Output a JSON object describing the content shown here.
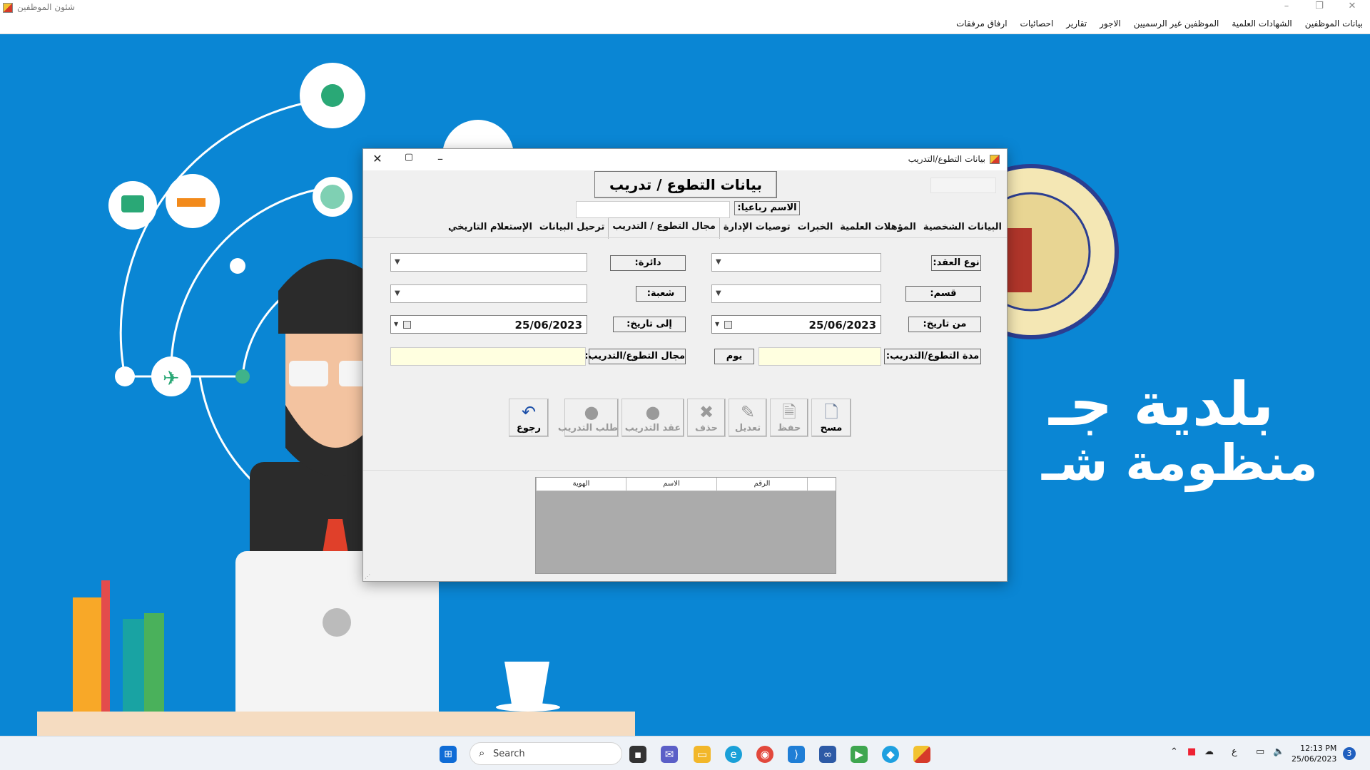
{
  "app": {
    "title": "شئون الموظفين",
    "menu": [
      "بيانات الموظفين",
      "الشهادات العلمية",
      "الموظفين غير الرسميين",
      "الاجور",
      "تقارير",
      "احصائيات",
      "ارفاق مرفقات"
    ]
  },
  "background": {
    "line1": "بلدية جـ",
    "line2": "منظومة شـ"
  },
  "dialog": {
    "title": "بيانات التطوع/التدريب",
    "header": "بيانات التطوع / تدريب",
    "name_label": "الاسم رباعيا:",
    "name_value": "",
    "tabs": [
      "البيانات الشخصية",
      "المؤهلات العلمية",
      "الخبرات",
      "توصيات الإدارة",
      "مجال التطوع / التدريب",
      "ترحيل البيانات",
      "الإستعلام التاريخي"
    ],
    "active_tab": 4,
    "form": {
      "contract_type_label": "نوع العقد:",
      "contract_type_value": "",
      "department_label": "دائرة:",
      "department_value": "",
      "section_label": "قسم:",
      "section_value": "",
      "division_label": "شعبة:",
      "division_value": "",
      "from_date_label": "من تاريخ:",
      "from_date_value": "25/06/2023",
      "to_date_label": "إلى تاريخ:",
      "to_date_value": "25/06/2023",
      "duration_label": "مدة التطوع/التدريب:",
      "duration_value": "",
      "day_label": "يوم",
      "field_label": "مجال التطوع/التدريب:",
      "field_value": ""
    },
    "buttons": {
      "new": "مسح",
      "save": "حفظ",
      "edit": "تعديل",
      "delete": "حذف",
      "training_contract": "عقد التدريب",
      "training_request": "طلب التدريب",
      "back": "رجوع"
    },
    "grid": {
      "columns": [
        "الرقم",
        "الاسم",
        "الهوية"
      ],
      "rows": []
    }
  },
  "taskbar": {
    "search_placeholder": "Search",
    "time": "12:13 PM",
    "date": "25/06/2023",
    "notifications": "3",
    "lang": "ع"
  }
}
